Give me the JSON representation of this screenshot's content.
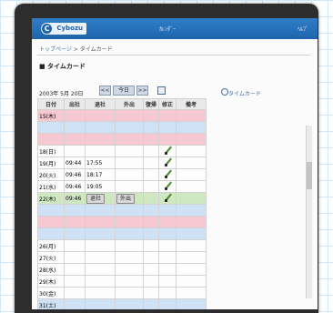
{
  "header": {
    "logo_mark": "C",
    "logo_text": "Cybozu",
    "nav_center": "ｶﾚﾝﾀﾞｰ",
    "nav_right": "ﾍﾙﾌﾟ"
  },
  "breadcrumb": {
    "home": "トップページ",
    "separator": " > ",
    "current": "タイムカード"
  },
  "page": {
    "title": "■ タイムカード"
  },
  "date_nav": {
    "date_text": "2003年 5月 20日",
    "prev_label": "<<",
    "today_label": "今日",
    "next_label": ">>",
    "side_link": "タイムカード"
  },
  "table": {
    "columns": [
      "日付",
      "出社",
      "退社",
      "外出",
      "復帰",
      "修正",
      "備考"
    ],
    "rows": [
      {
        "date": "15(木)",
        "in": "",
        "out": "",
        "memo": "",
        "type": "sun",
        "edit": false
      },
      {
        "date": "",
        "in": "",
        "out": "",
        "memo": "",
        "type": "sat",
        "edit": false
      },
      {
        "date": "",
        "in": "",
        "out": "",
        "memo": "",
        "type": "sun",
        "edit": false
      },
      {
        "date": "18(日)",
        "in": "",
        "out": "",
        "memo": "",
        "type": "weekday",
        "edit": true
      },
      {
        "date": "19(月)",
        "in": "09:44",
        "out": "17:55",
        "memo": "",
        "type": "weekday",
        "edit": true
      },
      {
        "date": "20(火)",
        "in": "09:46",
        "out": "18:17",
        "memo": "",
        "type": "weekday",
        "edit": true
      },
      {
        "date": "21(水)",
        "in": "09:46",
        "out": "19:05",
        "memo": "",
        "type": "weekday",
        "edit": true
      },
      {
        "date": "22(木)",
        "in": "09:46",
        "out": "退社",
        "memo": "外出",
        "type": "today",
        "edit": true
      },
      {
        "date": "",
        "in": "",
        "out": "",
        "memo": "",
        "type": "sat",
        "edit": false
      },
      {
        "date": "",
        "in": "",
        "out": "",
        "memo": "",
        "type": "sun",
        "edit": false
      },
      {
        "date": "",
        "in": "",
        "out": "",
        "memo": "",
        "type": "sat",
        "edit": false
      },
      {
        "date": "26(月)",
        "in": "",
        "out": "",
        "memo": "",
        "type": "weekday",
        "edit": false
      },
      {
        "date": "27(火)",
        "in": "",
        "out": "",
        "memo": "",
        "type": "weekday",
        "edit": false
      },
      {
        "date": "28(水)",
        "in": "",
        "out": "",
        "memo": "",
        "type": "weekday",
        "edit": false
      },
      {
        "date": "29(木)",
        "in": "",
        "out": "",
        "memo": "",
        "type": "weekday",
        "edit": false
      },
      {
        "date": "30(金)",
        "in": "",
        "out": "",
        "memo": "",
        "type": "weekday",
        "edit": false
      },
      {
        "date": "31(土)",
        "in": "",
        "out": "",
        "memo": "",
        "type": "sat",
        "edit": false
      }
    ]
  }
}
